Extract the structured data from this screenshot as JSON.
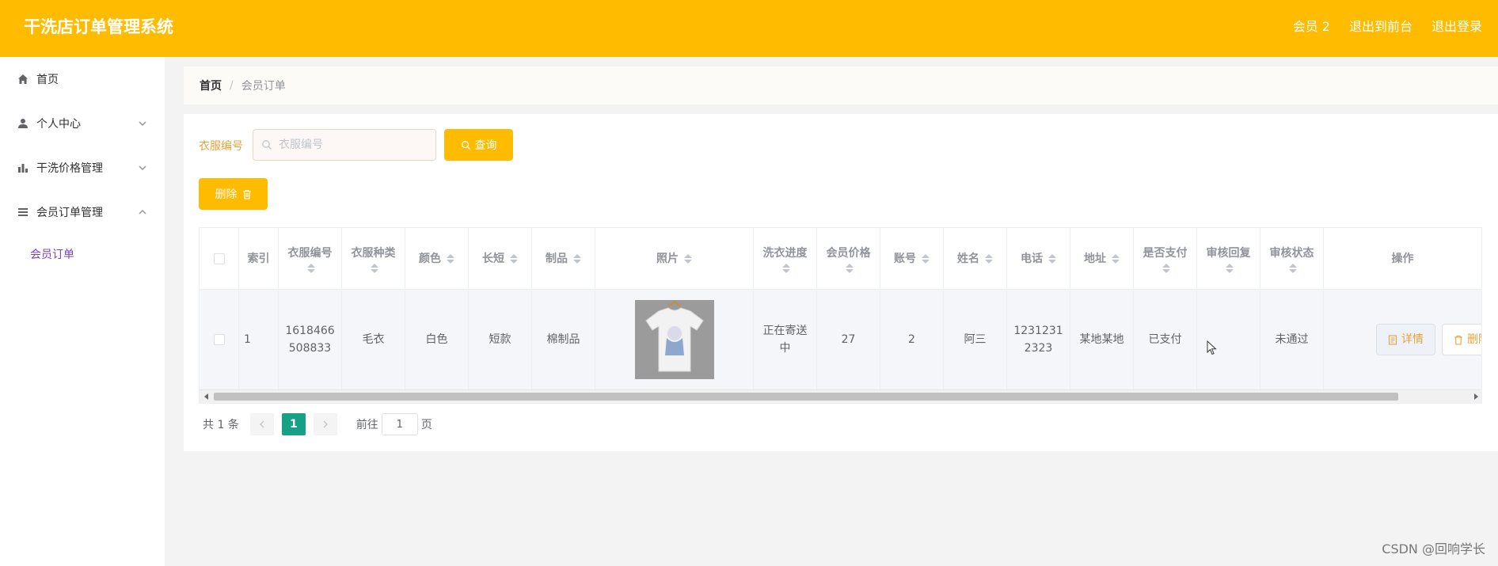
{
  "app": {
    "title": "干洗店订单管理系统",
    "top_links": [
      "会员 2",
      "退出到前台",
      "退出登录"
    ]
  },
  "sidebar": {
    "items": [
      {
        "label": "首页",
        "icon": "home-icon"
      },
      {
        "label": "个人中心",
        "icon": "user-icon",
        "expandable": true
      },
      {
        "label": "干洗价格管理",
        "icon": "bar-chart-icon",
        "expandable": true
      },
      {
        "label": "会员订单管理",
        "icon": "menu-list-icon",
        "expandable": true,
        "expanded": true
      }
    ],
    "submenu": [
      "会员订单"
    ]
  },
  "breadcrumb": {
    "home": "首页",
    "separator": "/",
    "current": "会员订单"
  },
  "search": {
    "label": "衣服编号",
    "placeholder": "衣服编号",
    "value": "",
    "query_button": "查询"
  },
  "actions": {
    "delete_button": "删除"
  },
  "table": {
    "columns": [
      {
        "key": "index",
        "label": "索引",
        "sortable": false
      },
      {
        "key": "clothes_no",
        "label": "衣服编号",
        "sortable": true
      },
      {
        "key": "clothes_type",
        "label": "衣服种类",
        "sortable": true
      },
      {
        "key": "color",
        "label": "颜色",
        "sortable": true
      },
      {
        "key": "length",
        "label": "长短",
        "sortable": true
      },
      {
        "key": "material",
        "label": "制品",
        "sortable": true
      },
      {
        "key": "photo",
        "label": "照片",
        "sortable": true
      },
      {
        "key": "progress",
        "label": "洗衣进度",
        "sortable": true
      },
      {
        "key": "price",
        "label": "会员价格",
        "sortable": true
      },
      {
        "key": "account",
        "label": "账号",
        "sortable": true
      },
      {
        "key": "name",
        "label": "姓名",
        "sortable": true
      },
      {
        "key": "phone",
        "label": "电话",
        "sortable": true
      },
      {
        "key": "address",
        "label": "地址",
        "sortable": true
      },
      {
        "key": "paid",
        "label": "是否支付",
        "sortable": true
      },
      {
        "key": "review_reply",
        "label": "审核回复",
        "sortable": true
      },
      {
        "key": "review_status",
        "label": "审核状态",
        "sortable": true
      },
      {
        "key": "ops",
        "label": "操作",
        "sortable": false
      }
    ],
    "rows": [
      {
        "index": "1",
        "clothes_no": "1618466508833",
        "clothes_type": "毛衣",
        "color": "白色",
        "length": "短款",
        "material": "棉制品",
        "photo": "",
        "progress": "正在寄送中",
        "price": "27",
        "account": "2",
        "name": "阿三",
        "phone": "12312312323",
        "address": "某地某地",
        "paid": "已支付",
        "review_reply": "",
        "review_status": "未通过",
        "detail_button": "详情",
        "delete_button": "删除"
      }
    ]
  },
  "pagination": {
    "total_text": "共 1 条",
    "current_page": "1",
    "goto_prefix": "前往",
    "goto_value": "1",
    "goto_suffix": "页"
  },
  "watermark": "CSDN @回响学长",
  "colors": {
    "accent": "#ffbb00",
    "page_active": "#16a085",
    "submenu_active": "#7b3fc4",
    "label": "#e6a23c"
  }
}
